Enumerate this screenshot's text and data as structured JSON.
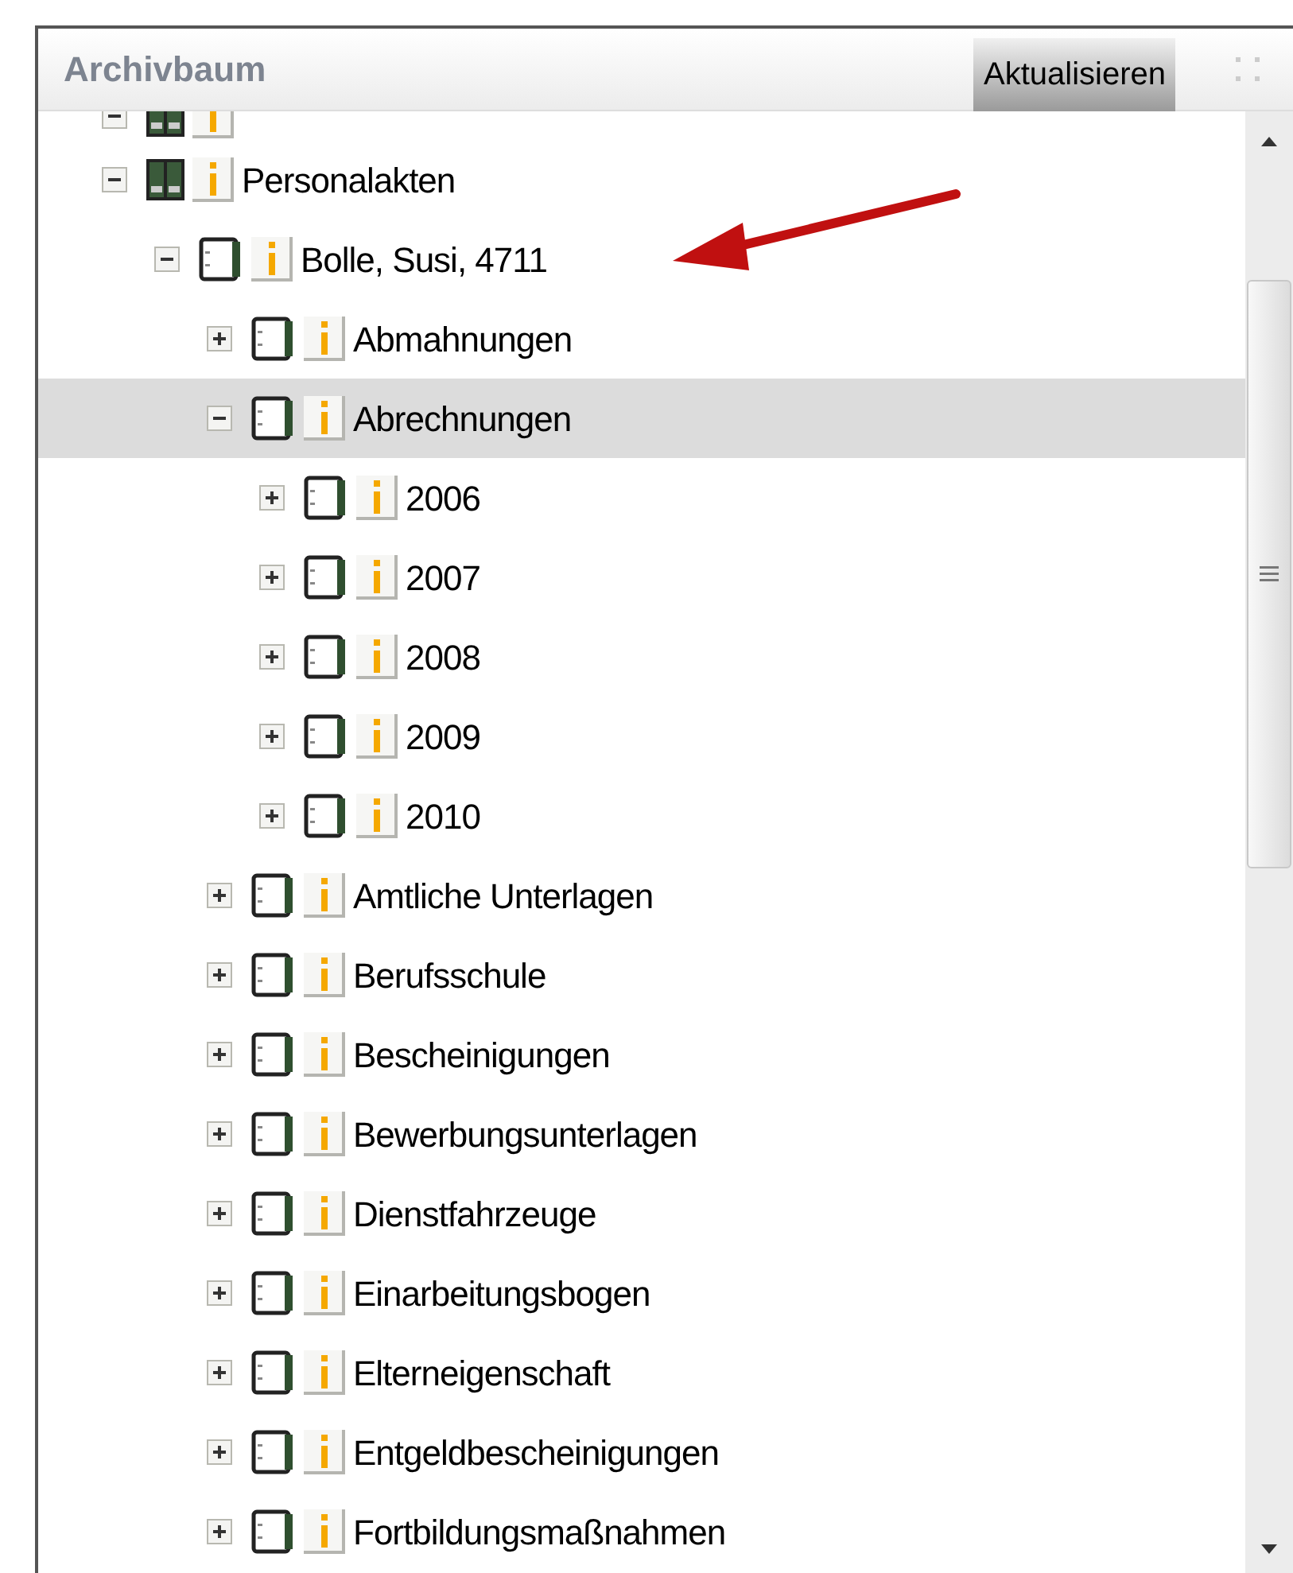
{
  "panel": {
    "title": "Archivbaum",
    "refresh_button": "Aktualisieren"
  },
  "tree": [
    {
      "kind": "cabinet",
      "expanded": true,
      "selected": false,
      "clipped": true
    },
    {
      "kind": "cabinet",
      "label": "Personalakten",
      "expanded": true,
      "selected": false,
      "children": [
        {
          "kind": "binder",
          "label": "Bolle, Susi, 4711",
          "expanded": true,
          "selected": false,
          "children": [
            {
              "kind": "binder",
              "label": "Abmahnungen",
              "expanded": false,
              "selected": false
            },
            {
              "kind": "binder",
              "label": "Abrechnungen",
              "expanded": true,
              "selected": true,
              "children": [
                {
                  "kind": "binder",
                  "label": "2006",
                  "expanded": false,
                  "selected": false
                },
                {
                  "kind": "binder",
                  "label": "2007",
                  "expanded": false,
                  "selected": false
                },
                {
                  "kind": "binder",
                  "label": "2008",
                  "expanded": false,
                  "selected": false
                },
                {
                  "kind": "binder",
                  "label": "2009",
                  "expanded": false,
                  "selected": false
                },
                {
                  "kind": "binder",
                  "label": "2010",
                  "expanded": false,
                  "selected": false
                }
              ]
            },
            {
              "kind": "binder",
              "label": "Amtliche Unterlagen",
              "expanded": false,
              "selected": false
            },
            {
              "kind": "binder",
              "label": "Berufsschule",
              "expanded": false,
              "selected": false
            },
            {
              "kind": "binder",
              "label": "Bescheinigungen",
              "expanded": false,
              "selected": false
            },
            {
              "kind": "binder",
              "label": "Bewerbungsunterlagen",
              "expanded": false,
              "selected": false
            },
            {
              "kind": "binder",
              "label": "Dienstfahrzeuge",
              "expanded": false,
              "selected": false
            },
            {
              "kind": "binder",
              "label": "Einarbeitungsbogen",
              "expanded": false,
              "selected": false
            },
            {
              "kind": "binder",
              "label": "Elterneigenschaft",
              "expanded": false,
              "selected": false
            },
            {
              "kind": "binder",
              "label": "Entgeldbescheinigungen",
              "expanded": false,
              "selected": false
            },
            {
              "kind": "binder",
              "label": "Fortbildungsmaßnahmen",
              "expanded": false,
              "selected": false
            }
          ]
        }
      ]
    }
  ]
}
